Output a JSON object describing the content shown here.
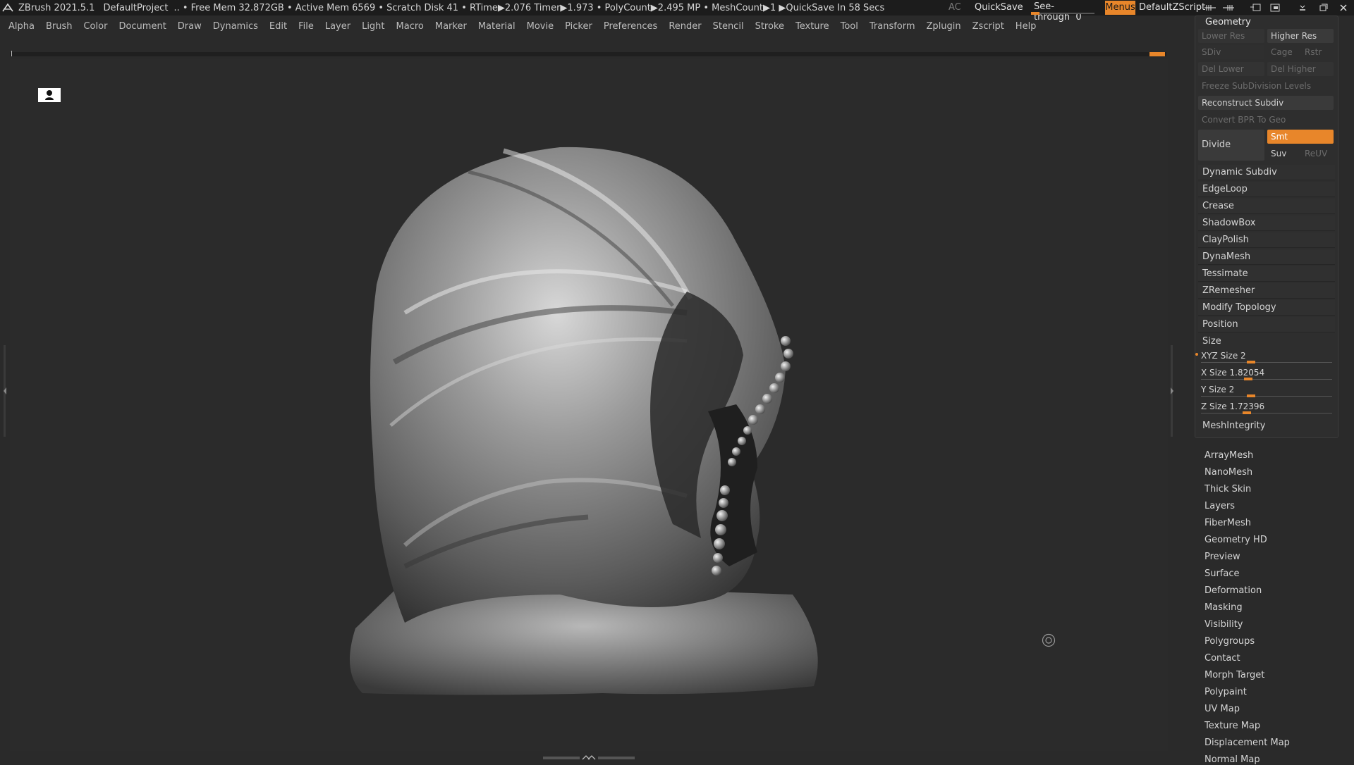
{
  "titlebar": {
    "app": "ZBrush 2021.5.1",
    "project": "DefaultProject",
    "stats": ".. • Free Mem 32.872GB • Active Mem 6569 • Scratch Disk 41 •  RTime▶2.076 Timer▶1.973 • PolyCount▶2.495 MP  • MeshCount▶1  ▶QuickSave In 58 Secs",
    "ac": "AC",
    "quicksave": "QuickSave",
    "seethrough_label": "See-through",
    "seethrough_value": "0",
    "menus": "Menus",
    "zscript": "DefaultZScript"
  },
  "menubar": [
    "Alpha",
    "Brush",
    "Color",
    "Document",
    "Draw",
    "Dynamics",
    "Edit",
    "File",
    "Layer",
    "Light",
    "Macro",
    "Marker",
    "Material",
    "Movie",
    "Picker",
    "Preferences",
    "Render",
    "Stencil",
    "Stroke",
    "Texture",
    "Tool",
    "Transform",
    "Zplugin",
    "Zscript",
    "Help"
  ],
  "geometry": {
    "title": "Geometry",
    "lower_res": "Lower Res",
    "higher_res": "Higher Res",
    "sdiv": "SDiv",
    "cage": "Cage",
    "rstr": "Rstr",
    "del_lower": "Del Lower",
    "del_higher": "Del Higher",
    "freeze": "Freeze SubDivision Levels",
    "reconstruct": "Reconstruct Subdiv",
    "convert_bpr": "Convert BPR To Geo",
    "divide": "Divide",
    "smt": "Smt",
    "suv": "Suv",
    "reuv": "ReUV",
    "items": [
      "Dynamic Subdiv",
      "EdgeLoop",
      "Crease",
      "ShadowBox",
      "ClayPolish",
      "DynaMesh",
      "Tessimate",
      "ZRemesher",
      "Modify Topology",
      "Position"
    ],
    "size_header": "Size",
    "sliders": [
      {
        "label": "XYZ Size",
        "value": "2",
        "level": 0.38
      },
      {
        "label": "X Size",
        "value": "1.82054",
        "level": 0.36
      },
      {
        "label": "Y Size",
        "value": "2",
        "level": 0.38
      },
      {
        "label": "Z Size",
        "value": "1.72396",
        "level": 0.35
      }
    ],
    "mesh_integrity": "MeshIntegrity"
  },
  "subpalettes": [
    "ArrayMesh",
    "NanoMesh",
    "Thick Skin",
    "Layers",
    "FiberMesh",
    "Geometry HD",
    "Preview",
    "Surface",
    "Deformation",
    "Masking",
    "Visibility",
    "Polygroups",
    "Contact",
    "Morph Target",
    "Polypaint",
    "UV Map",
    "Texture Map",
    "Displacement Map",
    "Normal Map"
  ],
  "colors": {
    "accent": "#e8862a",
    "bg": "#2a2a2a",
    "panel": "#2e2e2e"
  }
}
